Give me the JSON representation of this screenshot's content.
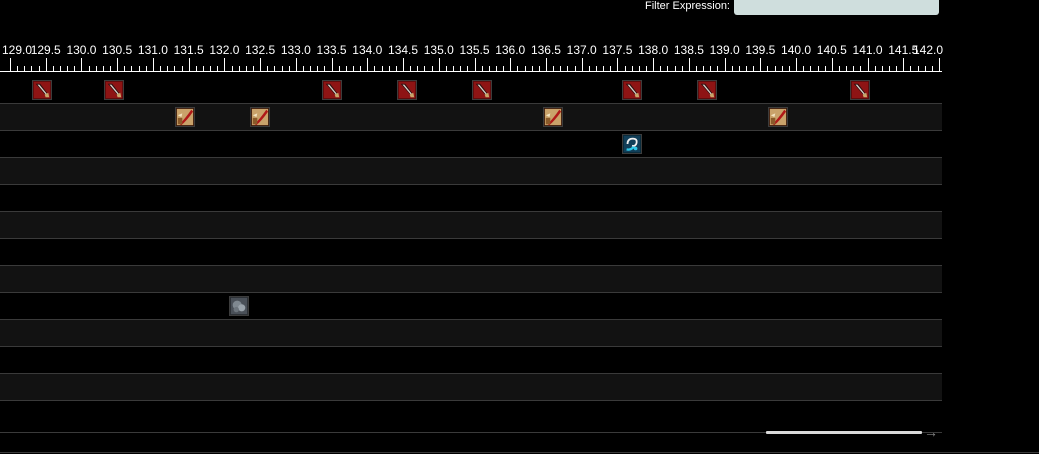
{
  "filter": {
    "label": "Filter Expression:",
    "value": ""
  },
  "timeline": {
    "start": 129.0,
    "end": 142.0,
    "tick_labels": [
      "129.0",
      "129.5",
      "130.0",
      "130.5",
      "131.0",
      "131.5",
      "132.0",
      "132.5",
      "133.0",
      "133.5",
      "134.0",
      "134.5",
      "135.0",
      "135.5",
      "136.0",
      "136.5",
      "137.0",
      "137.5",
      "138.0",
      "138.5",
      "139.0",
      "139.5",
      "140.0",
      "140.5",
      "141.0",
      "141.5",
      "142.0"
    ]
  },
  "rows": [
    {
      "events": [
        {
          "time": 129.45,
          "icon": "red-blade-skill-icon"
        },
        {
          "time": 130.45,
          "icon": "red-blade-skill-icon"
        },
        {
          "time": 133.5,
          "icon": "red-blade-skill-icon"
        },
        {
          "time": 134.55,
          "icon": "red-blade-skill-icon"
        },
        {
          "time": 135.6,
          "icon": "red-blade-skill-icon"
        },
        {
          "time": 137.7,
          "icon": "red-blade-skill-icon"
        },
        {
          "time": 138.75,
          "icon": "red-blade-skill-icon"
        },
        {
          "time": 140.9,
          "icon": "red-blade-skill-icon"
        }
      ]
    },
    {
      "events": [
        {
          "time": 131.45,
          "icon": "gold-red-slash-skill-icon"
        },
        {
          "time": 132.5,
          "icon": "gold-red-slash-skill-icon"
        },
        {
          "time": 136.6,
          "icon": "gold-red-slash-skill-icon"
        },
        {
          "time": 139.75,
          "icon": "gold-red-slash-skill-icon"
        }
      ]
    },
    {
      "events": [
        {
          "time": 137.7,
          "icon": "blue-swirl-skill-icon"
        }
      ]
    },
    {
      "events": []
    },
    {
      "events": []
    },
    {
      "events": []
    },
    {
      "events": []
    },
    {
      "events": []
    },
    {
      "events": [
        {
          "time": 132.2,
          "icon": "grey-smoke-skill-icon"
        }
      ]
    },
    {
      "events": []
    },
    {
      "events": []
    },
    {
      "events": []
    }
  ],
  "colors": {
    "background": "#000000",
    "row_alt": "#121212",
    "filter_input": "#cfdedd"
  }
}
